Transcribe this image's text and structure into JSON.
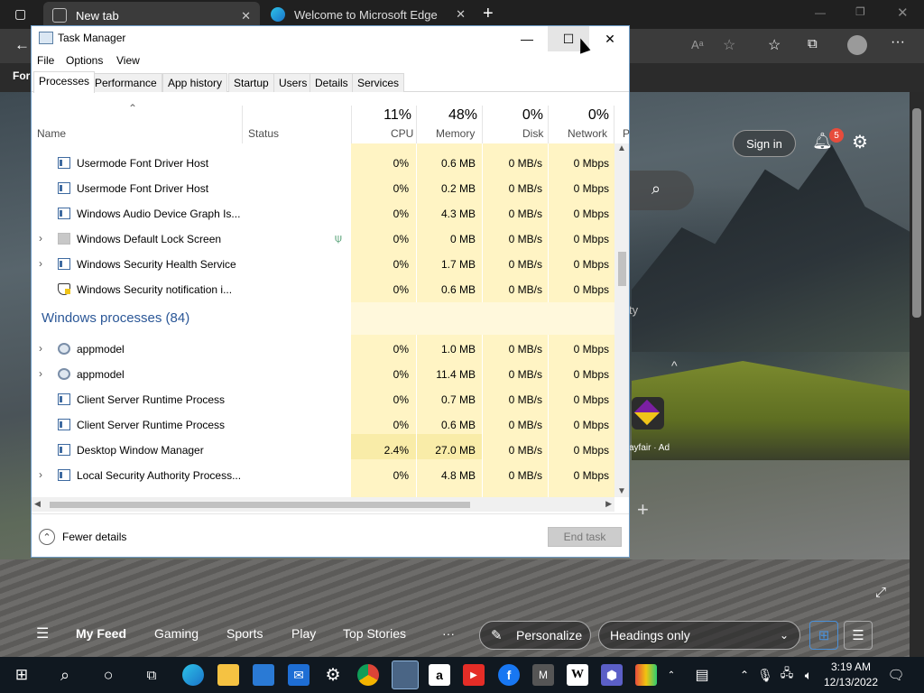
{
  "browser": {
    "tabs": [
      {
        "label": "New tab"
      },
      {
        "label": "Welcome to Microsoft Edge"
      }
    ],
    "left_stub": "For",
    "sign_in_label": "Sign in",
    "notification_count": "5",
    "side_text_1": "ty",
    "ad_label": "ayfair · Ad",
    "feed": {
      "items": [
        "My Feed",
        "Gaming",
        "Sports",
        "Play",
        "Top Stories"
      ],
      "more": "···",
      "personalize_label": "Personalize",
      "headings_value": "Headings only"
    }
  },
  "task_manager": {
    "title": "Task Manager",
    "menu": [
      "File",
      "Options",
      "View"
    ],
    "tabs": [
      "Processes",
      "Performance",
      "App history",
      "Startup",
      "Users",
      "Details",
      "Services"
    ],
    "active_tab": "Processes",
    "columns": {
      "name": "Name",
      "status": "Status",
      "cpu": {
        "pct": "11%",
        "label": "CPU"
      },
      "memory": {
        "pct": "48%",
        "label": "Memory"
      },
      "disk": {
        "pct": "0%",
        "label": "Disk"
      },
      "network": {
        "pct": "0%",
        "label": "Network"
      },
      "next": "P"
    },
    "rows": [
      {
        "name": "Usermode Font Driver Host",
        "cpu": "0%",
        "mem": "0.6 MB",
        "disk": "0 MB/s",
        "net": "0 Mbps"
      },
      {
        "name": "Usermode Font Driver Host",
        "cpu": "0%",
        "mem": "0.2 MB",
        "disk": "0 MB/s",
        "net": "0 Mbps"
      },
      {
        "name": "Windows Audio Device Graph Is...",
        "cpu": "0%",
        "mem": "4.3 MB",
        "disk": "0 MB/s",
        "net": "0 Mbps"
      },
      {
        "name": "Windows Default Lock Screen",
        "cpu": "0%",
        "mem": "0 MB",
        "disk": "0 MB/s",
        "net": "0 Mbps"
      },
      {
        "name": "Windows Security Health Service",
        "cpu": "0%",
        "mem": "1.7 MB",
        "disk": "0 MB/s",
        "net": "0 Mbps"
      },
      {
        "name": "Windows Security notification i...",
        "cpu": "0%",
        "mem": "0.6 MB",
        "disk": "0 MB/s",
        "net": "0 Mbps"
      }
    ],
    "group_title": "Windows processes (84)",
    "win_rows": [
      {
        "name": "appmodel",
        "cpu": "0%",
        "mem": "1.0 MB",
        "disk": "0 MB/s",
        "net": "0 Mbps"
      },
      {
        "name": "appmodel",
        "cpu": "0%",
        "mem": "11.4 MB",
        "disk": "0 MB/s",
        "net": "0 Mbps"
      },
      {
        "name": "Client Server Runtime Process",
        "cpu": "0%",
        "mem": "0.7 MB",
        "disk": "0 MB/s",
        "net": "0 Mbps"
      },
      {
        "name": "Client Server Runtime Process",
        "cpu": "0%",
        "mem": "0.6 MB",
        "disk": "0 MB/s",
        "net": "0 Mbps"
      },
      {
        "name": "Desktop Window Manager",
        "cpu": "2.4%",
        "mem": "27.0 MB",
        "disk": "0 MB/s",
        "net": "0 Mbps"
      },
      {
        "name": "Local Security Authority Process...",
        "cpu": "0%",
        "mem": "4.8 MB",
        "disk": "0 MB/s",
        "net": "0 Mbps"
      }
    ],
    "fewer_details": "Fewer details",
    "end_task": "End task"
  },
  "taskbar": {
    "time": "3:19 AM",
    "date": "12/13/2022"
  }
}
